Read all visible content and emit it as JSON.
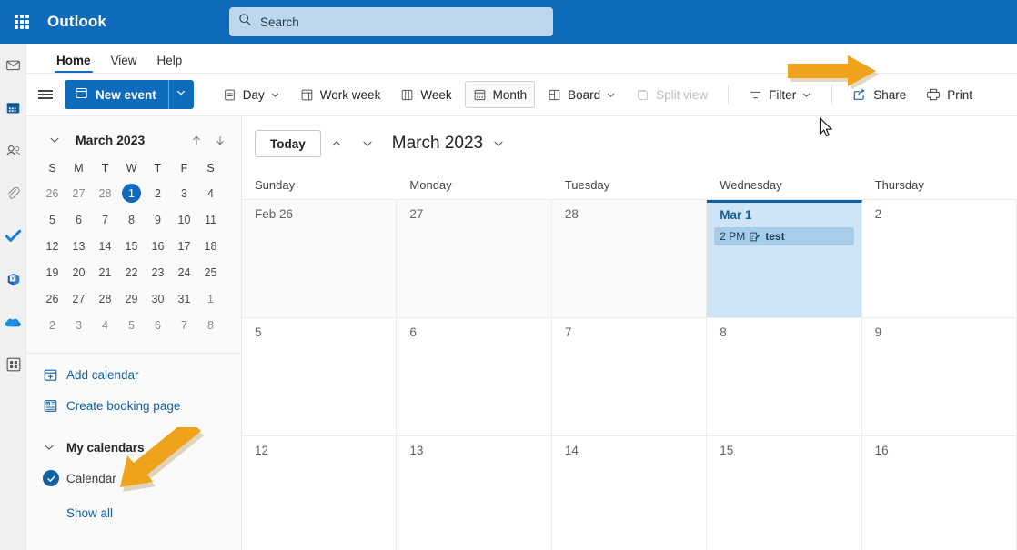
{
  "header": {
    "brand": "Outlook",
    "waffle_icon": "app-launcher-icon",
    "search": {
      "placeholder": "Search",
      "icon": "search-icon"
    },
    "colors": {
      "header_bg": "#0F6CBD",
      "search_bg": "#BCD7EC"
    }
  },
  "rail": {
    "items": [
      {
        "name": "mail-icon",
        "label": "Mail"
      },
      {
        "name": "calendar-icon",
        "label": "Calendar"
      },
      {
        "name": "people-icon",
        "label": "People"
      },
      {
        "name": "attachment-icon",
        "label": "Files"
      },
      {
        "name": "todo-icon",
        "label": "To Do"
      },
      {
        "name": "yammer-icon",
        "label": "Yammer"
      },
      {
        "name": "onedrive-icon",
        "label": "OneDrive"
      },
      {
        "name": "apps-icon",
        "label": "Apps"
      }
    ]
  },
  "tabs": [
    {
      "label": "Home",
      "active": true
    },
    {
      "label": "View",
      "active": false
    },
    {
      "label": "Help",
      "active": false
    }
  ],
  "toolbar": {
    "hamburger_icon": "hamburger-icon",
    "new_event": {
      "label": "New event",
      "icon": "calendar-event-icon",
      "caret_icon": "chevron-down-icon"
    },
    "commands": [
      {
        "label": "Day",
        "icon": "day-view-icon",
        "caret": true,
        "selected": false,
        "disabled": false
      },
      {
        "label": "Work week",
        "icon": "work-week-icon",
        "caret": false,
        "selected": false,
        "disabled": false
      },
      {
        "label": "Week",
        "icon": "week-view-icon",
        "caret": false,
        "selected": false,
        "disabled": false
      },
      {
        "label": "Month",
        "icon": "month-view-icon",
        "caret": false,
        "selected": true,
        "disabled": false
      },
      {
        "label": "Board",
        "icon": "board-view-icon",
        "caret": true,
        "selected": false,
        "disabled": false
      },
      {
        "label": "Split view",
        "icon": "split-view-icon",
        "caret": false,
        "selected": false,
        "disabled": true
      }
    ],
    "commands_right": [
      {
        "label": "Filter",
        "icon": "filter-icon",
        "caret": true
      },
      {
        "label": "Share",
        "icon": "share-icon",
        "caret": false
      },
      {
        "label": "Print",
        "icon": "print-icon",
        "caret": false
      }
    ]
  },
  "sidebar": {
    "mini_calendar": {
      "title": "March 2023",
      "collapse_icon": "chevron-down-icon",
      "prev_icon": "arrow-up-icon",
      "next_icon": "arrow-down-icon",
      "day_initials": [
        "S",
        "M",
        "T",
        "W",
        "T",
        "F",
        "S"
      ],
      "weeks": [
        [
          {
            "d": "26",
            "om": true
          },
          {
            "d": "27",
            "om": true
          },
          {
            "d": "28",
            "om": true
          },
          {
            "d": "1",
            "om": false,
            "today": true
          },
          {
            "d": "2",
            "om": false
          },
          {
            "d": "3",
            "om": false
          },
          {
            "d": "4",
            "om": false
          }
        ],
        [
          {
            "d": "5",
            "om": false
          },
          {
            "d": "6",
            "om": false
          },
          {
            "d": "7",
            "om": false
          },
          {
            "d": "8",
            "om": false
          },
          {
            "d": "9",
            "om": false
          },
          {
            "d": "10",
            "om": false
          },
          {
            "d": "11",
            "om": false
          }
        ],
        [
          {
            "d": "12",
            "om": false
          },
          {
            "d": "13",
            "om": false
          },
          {
            "d": "14",
            "om": false
          },
          {
            "d": "15",
            "om": false
          },
          {
            "d": "16",
            "om": false
          },
          {
            "d": "17",
            "om": false
          },
          {
            "d": "18",
            "om": false
          }
        ],
        [
          {
            "d": "19",
            "om": false
          },
          {
            "d": "20",
            "om": false
          },
          {
            "d": "21",
            "om": false
          },
          {
            "d": "22",
            "om": false
          },
          {
            "d": "23",
            "om": false
          },
          {
            "d": "24",
            "om": false
          },
          {
            "d": "25",
            "om": false
          }
        ],
        [
          {
            "d": "26",
            "om": false
          },
          {
            "d": "27",
            "om": false
          },
          {
            "d": "28",
            "om": false
          },
          {
            "d": "29",
            "om": false
          },
          {
            "d": "30",
            "om": false
          },
          {
            "d": "31",
            "om": false
          },
          {
            "d": "1",
            "om": true
          }
        ],
        [
          {
            "d": "2",
            "om": true
          },
          {
            "d": "3",
            "om": true
          },
          {
            "d": "4",
            "om": true
          },
          {
            "d": "5",
            "om": true
          },
          {
            "d": "6",
            "om": true
          },
          {
            "d": "7",
            "om": true
          },
          {
            "d": "8",
            "om": true
          }
        ]
      ]
    },
    "add_calendar": {
      "label": "Add calendar",
      "icon": "add-calendar-icon"
    },
    "create_booking": {
      "label": "Create booking page",
      "icon": "booking-page-icon"
    },
    "my_calendars": {
      "label": "My calendars",
      "chevron_icon": "chevron-down-icon"
    },
    "calendar_item": {
      "label": "Calendar",
      "checked": true,
      "check_icon": "check-icon"
    },
    "show_all": {
      "label": "Show all"
    }
  },
  "calendar": {
    "today_button": "Today",
    "prev_icon": "chevron-up-icon",
    "next_icon": "chevron-down-icon",
    "month_title": "March 2023",
    "month_caret_icon": "chevron-down-icon",
    "day_headers": [
      "Sunday",
      "Monday",
      "Tuesday",
      "Wednesday",
      "Thursday"
    ],
    "weeks": [
      [
        {
          "label": "Feb 26",
          "othermonth": true,
          "selected": false,
          "events": []
        },
        {
          "label": "27",
          "othermonth": true,
          "selected": false,
          "events": []
        },
        {
          "label": "28",
          "othermonth": true,
          "selected": false,
          "events": []
        },
        {
          "label": "Mar 1",
          "othermonth": false,
          "selected": true,
          "events": [
            {
              "time": "2 PM",
              "title": "test",
              "icon": "event-note-icon"
            }
          ]
        },
        {
          "label": "2",
          "othermonth": false,
          "selected": false,
          "events": []
        }
      ],
      [
        {
          "label": "5",
          "othermonth": false,
          "selected": false,
          "events": []
        },
        {
          "label": "6",
          "othermonth": false,
          "selected": false,
          "events": []
        },
        {
          "label": "7",
          "othermonth": false,
          "selected": false,
          "events": []
        },
        {
          "label": "8",
          "othermonth": false,
          "selected": false,
          "events": []
        },
        {
          "label": "9",
          "othermonth": false,
          "selected": false,
          "events": []
        }
      ],
      [
        {
          "label": "12",
          "othermonth": false,
          "selected": false,
          "events": []
        },
        {
          "label": "13",
          "othermonth": false,
          "selected": false,
          "events": []
        },
        {
          "label": "14",
          "othermonth": false,
          "selected": false,
          "events": []
        },
        {
          "label": "15",
          "othermonth": false,
          "selected": false,
          "events": []
        },
        {
          "label": "16",
          "othermonth": false,
          "selected": false,
          "events": []
        }
      ]
    ]
  },
  "annotations": {
    "arrow_color": "#EFA31D",
    "arrow_share": {
      "target": "Share"
    },
    "arrow_calendar": {
      "target": "Calendar"
    },
    "cursor_icon": "mouse-pointer-icon"
  }
}
